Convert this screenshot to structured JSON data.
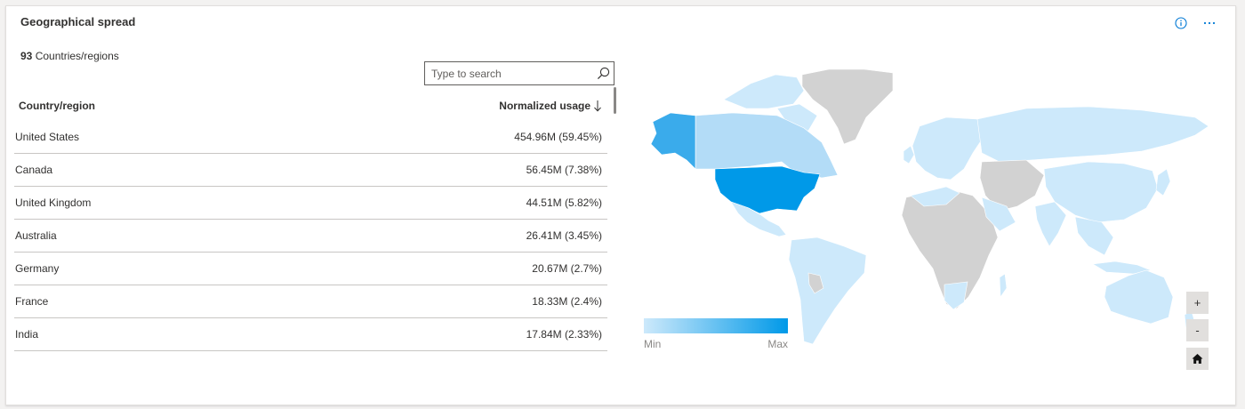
{
  "widget": {
    "title": "Geographical spread",
    "info_icon": "info-icon",
    "more_icon": "more-horizontal-icon"
  },
  "summary": {
    "count": "93",
    "label": "Countries/regions"
  },
  "search": {
    "placeholder": "Type to search",
    "icon": "search-icon"
  },
  "table": {
    "col_country": "Country/region",
    "col_usage": "Normalized usage",
    "sort_icon": "arrow-down-icon",
    "rows": [
      {
        "country": "United States",
        "usage": "454.96M (59.45%)"
      },
      {
        "country": "Canada",
        "usage": "56.45M (7.38%)"
      },
      {
        "country": "United Kingdom",
        "usage": "44.51M (5.82%)"
      },
      {
        "country": "Australia",
        "usage": "26.41M (3.45%)"
      },
      {
        "country": "Germany",
        "usage": "20.67M (2.7%)"
      },
      {
        "country": "France",
        "usage": "18.33M (2.4%)"
      },
      {
        "country": "India",
        "usage": "17.84M (2.33%)"
      }
    ]
  },
  "legend": {
    "min": "Min",
    "max": "Max"
  },
  "zoom": {
    "in": "+",
    "out": "-",
    "home_icon": "home-icon"
  },
  "colors": {
    "max": "#0099e8",
    "high": "#3aabeb",
    "mid": "#b3dcf7",
    "low": "#cde9fb",
    "no_data": "#d2d2d2",
    "accent": "#0078d4"
  }
}
